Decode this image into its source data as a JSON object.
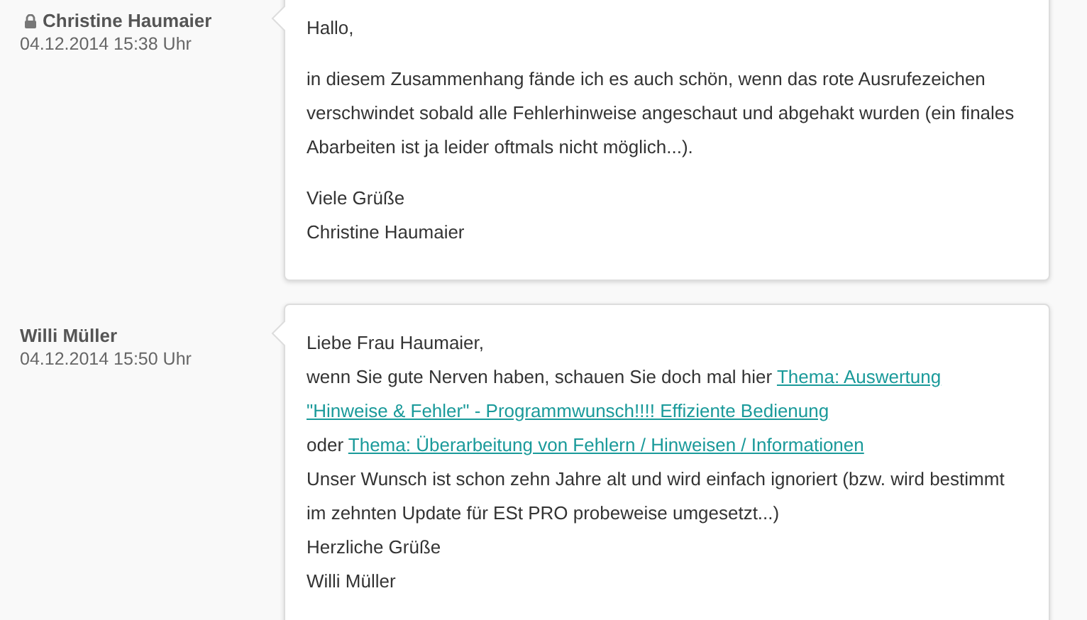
{
  "posts": [
    {
      "author": "Christine Haumaier",
      "locked": true,
      "date": "04.12.2014 15:38 Uhr",
      "kind": "paragraphs",
      "body": [
        [
          {
            "text": "Hallo,"
          }
        ],
        [
          {
            "text": "in diesem Zusammenhang fände ich es auch schön, wenn das rote Ausrufezeichen verschwindet sobald alle Fehlerhinweise angeschaut und abgehakt wurden (ein finales Abarbeiten ist ja leider oftmals nicht möglich...)."
          }
        ],
        [
          {
            "text": "Viele Grüße"
          },
          {
            "text": "Christine Haumaier"
          }
        ]
      ]
    },
    {
      "author": "Willi Müller",
      "locked": false,
      "date": "04.12.2014 15:50 Uhr",
      "kind": "lines",
      "body": [
        [
          {
            "text": "Liebe Frau Haumaier,"
          }
        ],
        [
          {
            "text": "wenn Sie gute Nerven haben, schauen Sie doch mal hier "
          },
          {
            "link": "Thema: Auswertung"
          },
          {
            "link": "\"Hinweise & Fehler\" - Programmwunsch!!!! Effiziente Bedienung"
          }
        ],
        [
          {
            "text": "oder "
          },
          {
            "link": "Thema: Überarbeitung von Fehlern / Hinweisen / Informationen"
          }
        ],
        [
          {
            "text": "Unser Wunsch ist schon zehn Jahre alt und wird einfach ignoriert (bzw. wird bestimmt im zehnten Update für ESt PRO probeweise umgesetzt...)"
          }
        ],
        [
          {
            "text": "Herzliche Grüße"
          }
        ],
        [
          {
            "text": "Willi Müller"
          }
        ]
      ]
    }
  ]
}
